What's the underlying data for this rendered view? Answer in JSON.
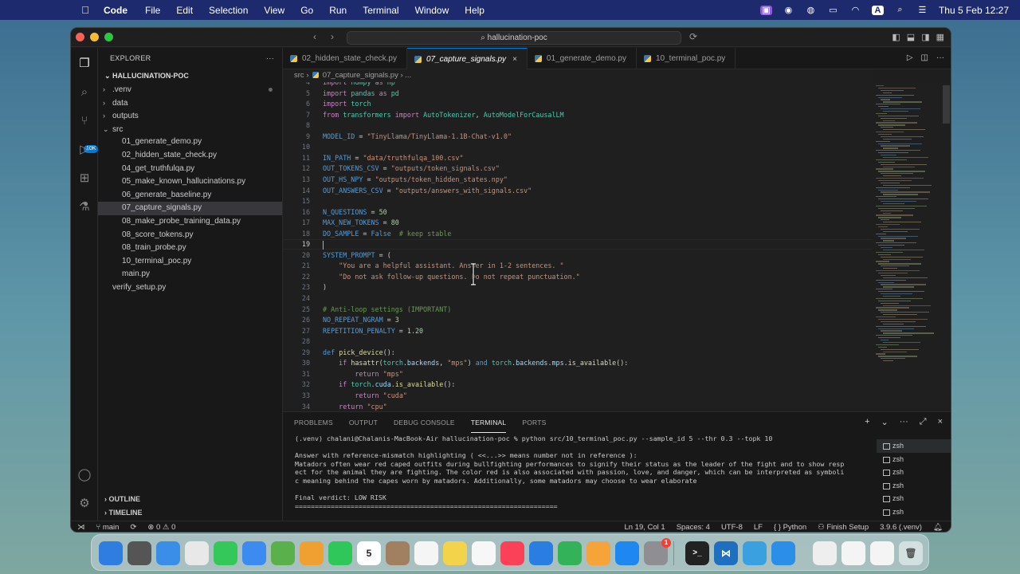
{
  "menubar": {
    "app_name": "Code",
    "menus": [
      "File",
      "Edit",
      "Selection",
      "View",
      "Go",
      "Run",
      "Terminal",
      "Window",
      "Help"
    ],
    "clock": "Thu 5 Feb  12:27",
    "input_source": "A"
  },
  "window": {
    "search_title": "hallucination-poc"
  },
  "activitybar": {
    "source_control_badge": "10K"
  },
  "sidebar": {
    "title": "EXPLORER",
    "more": "···",
    "root": "HALLUCINATION-POC",
    "items": [
      {
        "label": ".venv",
        "chev": "›",
        "indent": 1
      },
      {
        "label": "data",
        "chev": "›",
        "indent": 1
      },
      {
        "label": "outputs",
        "chev": "›",
        "indent": 1
      },
      {
        "label": "src",
        "chev": "⌄",
        "indent": 1
      },
      {
        "label": "01_generate_demo.py",
        "chev": "",
        "indent": 2
      },
      {
        "label": "02_hidden_state_check.py",
        "chev": "",
        "indent": 2
      },
      {
        "label": "04_get_truthfulqa.py",
        "chev": "",
        "indent": 2
      },
      {
        "label": "05_make_known_hallucinations.py",
        "chev": "",
        "indent": 2
      },
      {
        "label": "06_generate_baseline.py",
        "chev": "",
        "indent": 2
      },
      {
        "label": "07_capture_signals.py",
        "chev": "",
        "indent": 2
      },
      {
        "label": "08_make_probe_training_data.py",
        "chev": "",
        "indent": 2
      },
      {
        "label": "08_score_tokens.py",
        "chev": "",
        "indent": 2
      },
      {
        "label": "08_train_probe.py",
        "chev": "",
        "indent": 2
      },
      {
        "label": "10_terminal_poc.py",
        "chev": "",
        "indent": 2
      },
      {
        "label": "main.py",
        "chev": "",
        "indent": 2
      },
      {
        "label": "verify_setup.py",
        "chev": "",
        "indent": 1
      }
    ],
    "outline": "OUTLINE",
    "timeline": "TIMELINE"
  },
  "tabs": [
    {
      "label": "02_hidden_state_check.py",
      "active": false
    },
    {
      "label": "07_capture_signals.py",
      "active": true
    },
    {
      "label": "01_generate_demo.py",
      "active": false
    },
    {
      "label": "10_terminal_poc.py",
      "active": false
    }
  ],
  "tab_close": "×",
  "breadcrumb": {
    "folder": "src",
    "sep": "›",
    "file": "07_capture_signals.py",
    "trail": "› ..."
  },
  "editor": {
    "lines": [
      {
        "n": "4",
        "html": "<span class='k'>import</span> <span class='cl'>numpy</span> <span class='k'>as</span> <span class='cl'>np</span>"
      },
      {
        "n": "5",
        "html": "<span class='k'>import</span> <span class='cl'>pandas</span> <span class='k'>as</span> <span class='cl'>pd</span>"
      },
      {
        "n": "6",
        "html": "<span class='k'>import</span> <span class='cl'>torch</span>"
      },
      {
        "n": "7",
        "html": "<span class='k'>from</span> <span class='cl'>transformers</span> <span class='k'>import</span> <span class='cl'>AutoTokenizer</span>, <span class='cl'>AutoModelForCausalLM</span>"
      },
      {
        "n": "8",
        "html": ""
      },
      {
        "n": "9",
        "html": "<span class='kd'>MODEL_ID</span> = <span class='s'>\"TinyLlama/TinyLlama-1.1B-Chat-v1.0\"</span>"
      },
      {
        "n": "10",
        "html": ""
      },
      {
        "n": "11",
        "html": "<span class='kd'>IN_PATH</span> = <span class='s'>\"data/truthfulqa_100.csv\"</span>"
      },
      {
        "n": "12",
        "html": "<span class='kd'>OUT_TOKENS_CSV</span> = <span class='s'>\"outputs/token_signals.csv\"</span>"
      },
      {
        "n": "13",
        "html": "<span class='kd'>OUT_HS_NPY</span> = <span class='s'>\"outputs/token_hidden_states.npy\"</span>"
      },
      {
        "n": "14",
        "html": "<span class='kd'>OUT_ANSWERS_CSV</span> = <span class='s'>\"outputs/answers_with_signals.csv\"</span>"
      },
      {
        "n": "15",
        "html": ""
      },
      {
        "n": "16",
        "html": "<span class='kd'>N_QUESTIONS</span> = <span class='n'>50</span>"
      },
      {
        "n": "17",
        "html": "<span class='kd'>MAX_NEW_TOKENS</span> = <span class='n'>80</span>"
      },
      {
        "n": "18",
        "html": "<span class='kd'>DO_SAMPLE</span> = <span class='kd'>False</span>  <span class='c'># keep stable</span>"
      },
      {
        "n": "19",
        "html": ""
      },
      {
        "n": "20",
        "html": "<span class='kd'>SYSTEM_PROMPT</span> = ("
      },
      {
        "n": "21",
        "html": "    <span class='s'>\"You are a helpful assistant. Answer in 1-2 sentences. \"</span>"
      },
      {
        "n": "22",
        "html": "    <span class='s'>\"Do not ask follow-up questions. Do not repeat punctuation.\"</span>"
      },
      {
        "n": "23",
        "html": ")"
      },
      {
        "n": "24",
        "html": ""
      },
      {
        "n": "25",
        "html": "<span class='c'># Anti-loop settings (IMPORTANT)</span>"
      },
      {
        "n": "26",
        "html": "<span class='kd'>NO_REPEAT_NGRAM</span> = <span class='n'>3</span>"
      },
      {
        "n": "27",
        "html": "<span class='kd'>REPETITION_PENALTY</span> = <span class='n'>1.20</span>"
      },
      {
        "n": "28",
        "html": ""
      },
      {
        "n": "29",
        "html": "<span class='kd'>def</span> <span class='f'>pick_device</span>():"
      },
      {
        "n": "30",
        "html": "    <span class='k'>if</span> <span class='f'>hasattr</span>(<span class='cl'>torch</span>.<span class='v'>backends</span>, <span class='s'>\"mps\"</span>) <span class='kd'>and</span> <span class='cl'>torch</span>.<span class='v'>backends</span>.<span class='v'>mps</span>.<span class='f'>is_available</span>():"
      },
      {
        "n": "31",
        "html": "        <span class='k'>return</span> <span class='s'>\"mps\"</span>"
      },
      {
        "n": "32",
        "html": "    <span class='k'>if</span> <span class='cl'>torch</span>.<span class='v'>cuda</span>.<span class='f'>is_available</span>():"
      },
      {
        "n": "33",
        "html": "        <span class='k'>return</span> <span class='s'>\"cuda\"</span>"
      },
      {
        "n": "34",
        "html": "    <span class='k'>return</span> <span class='s'>\"cpu\"</span>"
      }
    ]
  },
  "panel": {
    "tabs": [
      "PROBLEMS",
      "OUTPUT",
      "DEBUG CONSOLE",
      "TERMINAL",
      "PORTS"
    ],
    "active_tab": "TERMINAL",
    "terminal_lines": [
      "(.venv) chalani@Chalanis-MacBook-Air hallucination-poc % python src/10_terminal_poc.py --sample_id 5 --thr 0.3 --topk 10",
      "",
      "Answer with reference-mismatch highlighting ( <<...>> means number not in reference ):",
      "Matadors often wear red caped outfits during bullfighting performances to signify their status as the leader of the fight and to show resp",
      "ect for the animal they are fighting. The color red is also associated with passion, love, and danger, which can be interpreted as symboli",
      "c meaning behind the capes worn by matadors. Additionally, some matadors may choose to wear elaborate",
      "",
      "Final verdict: LOW RISK",
      "=================================================================="
    ],
    "terminal_list": [
      "zsh",
      "zsh",
      "zsh",
      "zsh",
      "zsh",
      "zsh",
      "zsh"
    ]
  },
  "statusbar": {
    "branch": "main",
    "errors": "⊗ 0 ⚠ 0",
    "position": "Ln 19, Col 1",
    "spaces": "Spaces: 4",
    "encoding": "UTF-8",
    "eol": "LF",
    "language": "{ } Python",
    "finish_setup": "Finish Setup",
    "interpreter": "3.9.6 (.venv)"
  },
  "dock": {
    "calendar_day": "5",
    "notification_badge": "1",
    "icons": [
      "finder-icon",
      "launchpad-icon",
      "safari-icon",
      "chrome-icon",
      "messages-icon",
      "mail-icon",
      "maps-icon",
      "photos-icon",
      "facetime-icon",
      "calendar-icon",
      "contacts-icon",
      "reminders-icon",
      "notes-icon",
      "freeform-icon",
      "music-icon",
      "keynote-icon",
      "numbers-icon",
      "pages-icon",
      "app-store-icon",
      "system-settings-icon",
      "terminal-icon",
      "vscode-icon",
      "qt-icon",
      "browser-icon",
      "window-thumb-icon",
      "window-thumb-icon",
      "window-thumb-icon",
      "trash-icon"
    ],
    "colors": {
      "accent": "#0078d4",
      "menubar": "#1e2a6e"
    }
  }
}
